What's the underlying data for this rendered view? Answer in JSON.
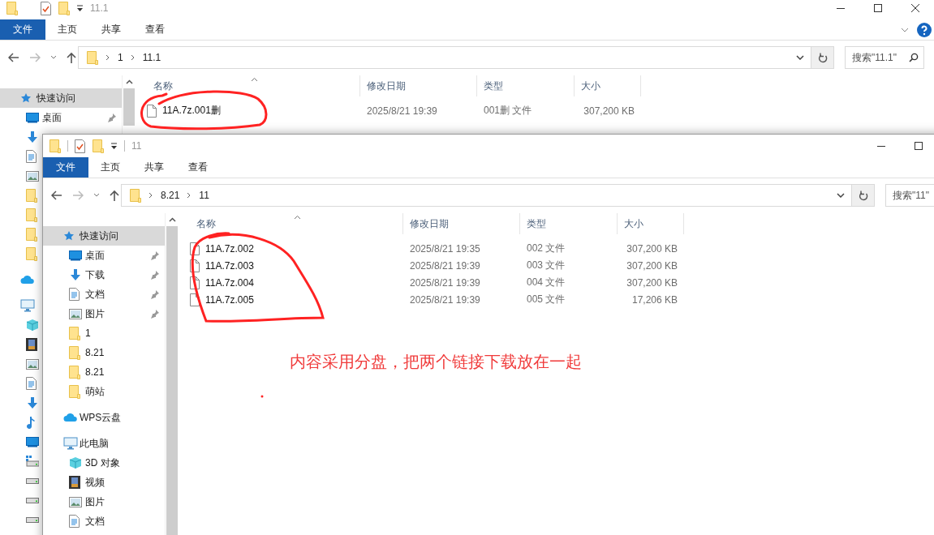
{
  "windows": [
    {
      "title": "11.1",
      "controls": [
        {
          "kind": "minimize"
        },
        {
          "kind": "maximize"
        },
        {
          "kind": "close"
        }
      ],
      "ribbon_tabs": [
        {
          "label": "文件",
          "selected": true
        },
        {
          "label": "主页",
          "selected": false
        },
        {
          "label": "共享",
          "selected": false
        },
        {
          "label": "查看",
          "selected": false
        }
      ],
      "help": true,
      "address": [
        "1",
        "11.1"
      ],
      "search": {
        "placeholder": "搜索\"11.1\"",
        "icon": true
      },
      "nav": [
        {
          "kind": "star",
          "label": "快速访问",
          "selected": true,
          "children": [
            {
              "kind": "desktop",
              "label": "桌面",
              "pinned": true,
              "selected": false
            },
            {
              "kind": "download",
              "selected": false
            },
            {
              "kind": "document",
              "selected": false
            },
            {
              "kind": "picture",
              "selected": false
            },
            {
              "kind": "folder",
              "selected": false
            },
            {
              "kind": "folder",
              "selected": false
            },
            {
              "kind": "folder",
              "selected": false
            },
            {
              "kind": "folder",
              "selected": false
            }
          ]
        },
        {
          "kind": "cloud",
          "selected": false
        },
        {
          "kind": "computer",
          "selected": false,
          "children": [
            {
              "kind": "cube",
              "selected": false
            },
            {
              "kind": "video",
              "selected": false
            },
            {
              "kind": "picture",
              "selected": false
            },
            {
              "kind": "document",
              "selected": false
            },
            {
              "kind": "download",
              "selected": false
            },
            {
              "kind": "music",
              "selected": false
            },
            {
              "kind": "desktop",
              "selected": false
            },
            {
              "kind": "windows-drive",
              "selected": false
            },
            {
              "kind": "drive",
              "selected": false
            },
            {
              "kind": "drive",
              "selected": false
            },
            {
              "kind": "drive",
              "selected": false
            }
          ]
        }
      ],
      "columns": [
        "名称",
        "修改日期",
        "类型",
        "大小"
      ],
      "files": [
        {
          "name": "11A.7z.001删",
          "date": "2025/8/21 19:39",
          "type": "001删 文件",
          "size": "307,200 KB"
        }
      ]
    },
    {
      "title": "11",
      "controls": [
        {
          "kind": "minimize"
        },
        {
          "kind": "maximize"
        }
      ],
      "ribbon_tabs": [
        {
          "label": "文件",
          "selected": true
        },
        {
          "label": "主页",
          "selected": false
        },
        {
          "label": "共享",
          "selected": false
        },
        {
          "label": "查看",
          "selected": false
        }
      ],
      "address": [
        "8.21",
        "11"
      ],
      "search": {
        "placeholder": "搜索\"11\""
      },
      "nav": [
        {
          "kind": "star",
          "label": "快速访问",
          "selected": true,
          "children": [
            {
              "kind": "desktop",
              "label": "桌面",
              "pinned": true,
              "selected": false
            },
            {
              "kind": "download",
              "label": "下载",
              "pinned": true,
              "selected": false
            },
            {
              "kind": "document",
              "label": "文档",
              "pinned": true,
              "selected": false
            },
            {
              "kind": "picture",
              "label": "图片",
              "pinned": true,
              "selected": false
            },
            {
              "kind": "folder",
              "label": "1",
              "pinned": false,
              "selected": false
            },
            {
              "kind": "folder",
              "label": "8.21",
              "pinned": false,
              "selected": false
            },
            {
              "kind": "folder",
              "label": "8.21",
              "pinned": false,
              "selected": false
            },
            {
              "kind": "folder",
              "label": "萌站",
              "pinned": false,
              "selected": false
            }
          ]
        },
        {
          "kind": "cloud",
          "label": "WPS云盘",
          "selected": false
        },
        {
          "kind": "computer",
          "label": "此电脑",
          "selected": false,
          "children": [
            {
              "kind": "cube",
              "label": "3D 对象",
              "selected": false
            },
            {
              "kind": "video",
              "label": "视频",
              "selected": false
            },
            {
              "kind": "picture",
              "label": "图片",
              "selected": false
            },
            {
              "kind": "document",
              "label": "文档",
              "selected": false
            }
          ]
        }
      ],
      "columns": [
        "名称",
        "修改日期",
        "类型",
        "大小"
      ],
      "files": [
        {
          "name": "11A.7z.002",
          "date": "2025/8/21 19:35",
          "type": "002 文件",
          "size": "307,200 KB"
        },
        {
          "name": "11A.7z.003",
          "date": "2025/8/21 19:39",
          "type": "003 文件",
          "size": "307,200 KB"
        },
        {
          "name": "11A.7z.004",
          "date": "2025/8/21 19:39",
          "type": "004 文件",
          "size": "307,200 KB"
        },
        {
          "name": "11A.7z.005",
          "date": "2025/8/21 19:39",
          "type": "005 文件",
          "size": "17,206 KB"
        }
      ]
    }
  ],
  "note": "内容采用分盘，把两个链接下载放在一起"
}
